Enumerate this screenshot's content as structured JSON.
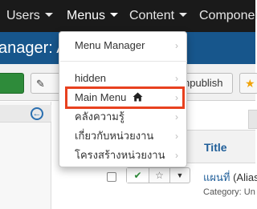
{
  "nav": {
    "items": [
      {
        "label": "Users"
      },
      {
        "label": "Menus"
      },
      {
        "label": "Content"
      },
      {
        "label": "Componen"
      }
    ]
  },
  "header": {
    "title": "anager: A"
  },
  "toolbar": {
    "unpublish_label": "npublish"
  },
  "menus_dropdown": {
    "items": [
      {
        "label": "Menu Manager"
      },
      {
        "label": "hidden"
      },
      {
        "label": "Main Menu"
      },
      {
        "label": "คลังความรู้"
      },
      {
        "label": "เกี่ยวกับหน่วยงาน"
      },
      {
        "label": "โครงสร้างหน่วยงาน"
      }
    ],
    "highlighted": "Main Menu"
  },
  "table": {
    "title_header": "Title",
    "row": {
      "title": "แผนที่",
      "alias": " (Alias:",
      "category": "Category: Un"
    }
  },
  "colors": {
    "nav_bg": "#1a1a1a",
    "header_bg": "#17568c",
    "highlight_border": "#e8411f",
    "link": "#1f5e99",
    "publish_green": "#2e8b3a"
  }
}
